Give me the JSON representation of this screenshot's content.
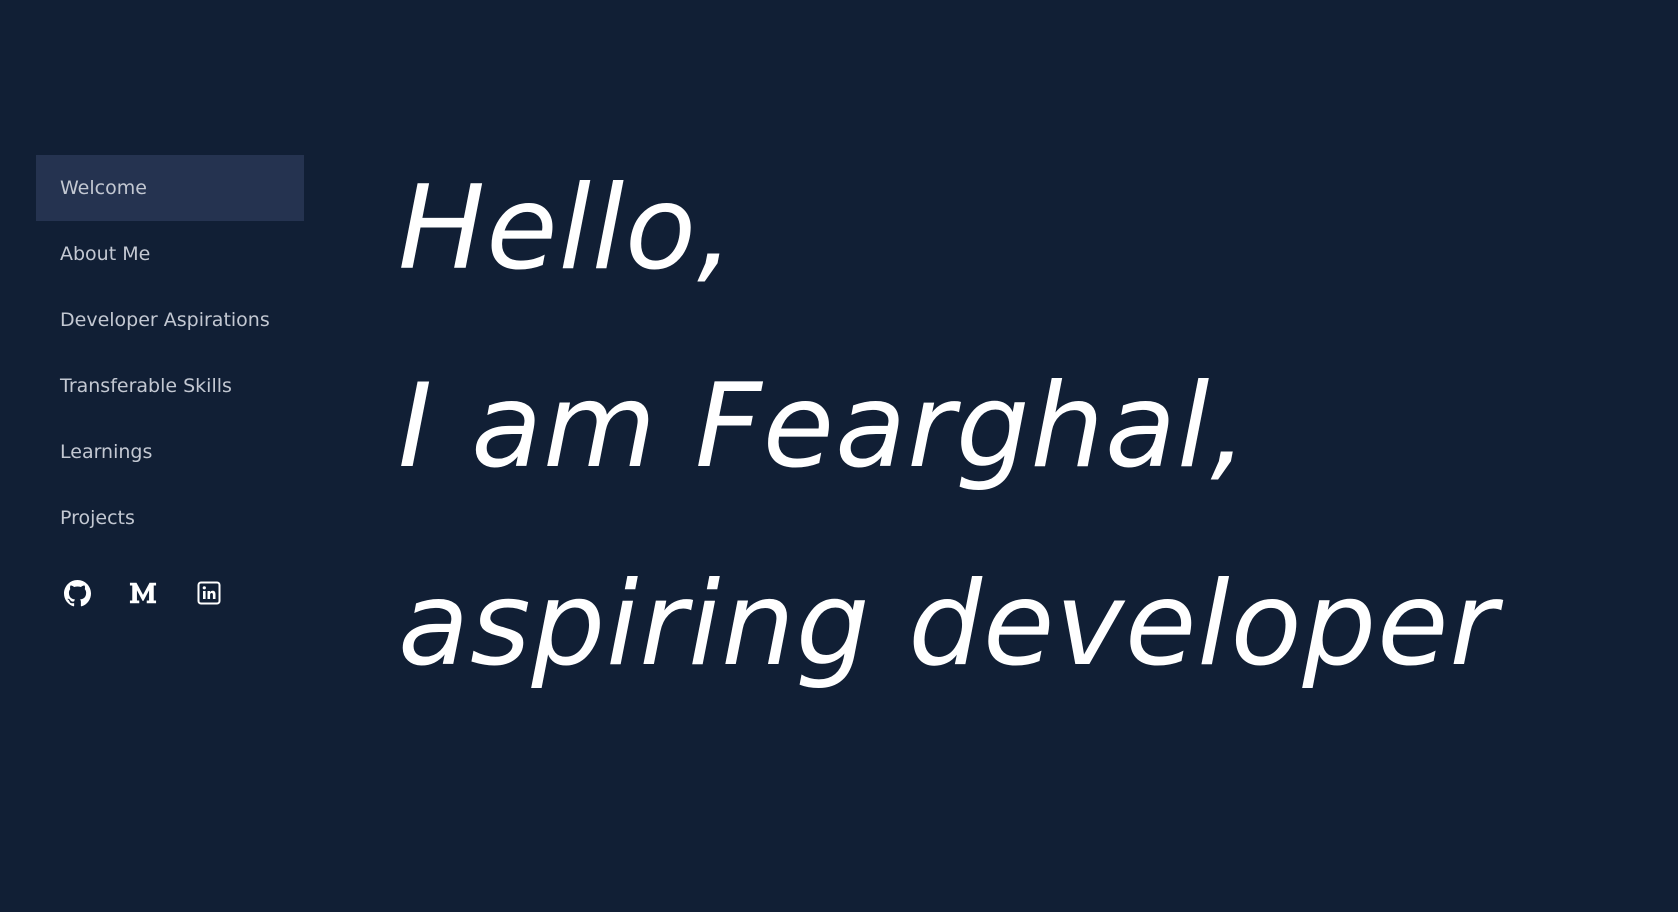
{
  "sidebar": {
    "items": [
      {
        "label": "Welcome",
        "active": true
      },
      {
        "label": "About Me",
        "active": false
      },
      {
        "label": "Developer Aspirations",
        "active": false
      },
      {
        "label": "Transferable Skills",
        "active": false
      },
      {
        "label": "Learnings",
        "active": false
      },
      {
        "label": "Projects",
        "active": false
      }
    ],
    "socials": [
      {
        "icon": "github-icon"
      },
      {
        "icon": "medium-icon"
      },
      {
        "icon": "linkedin-icon"
      }
    ]
  },
  "hero": {
    "line1": "Hello,",
    "line2": "I am Fearghal,",
    "line3": "aspiring developer"
  },
  "colors": {
    "background": "#111f35",
    "active_item": "#253350",
    "nav_text": "#c3c8d2",
    "hero_text": "#ffffff"
  }
}
